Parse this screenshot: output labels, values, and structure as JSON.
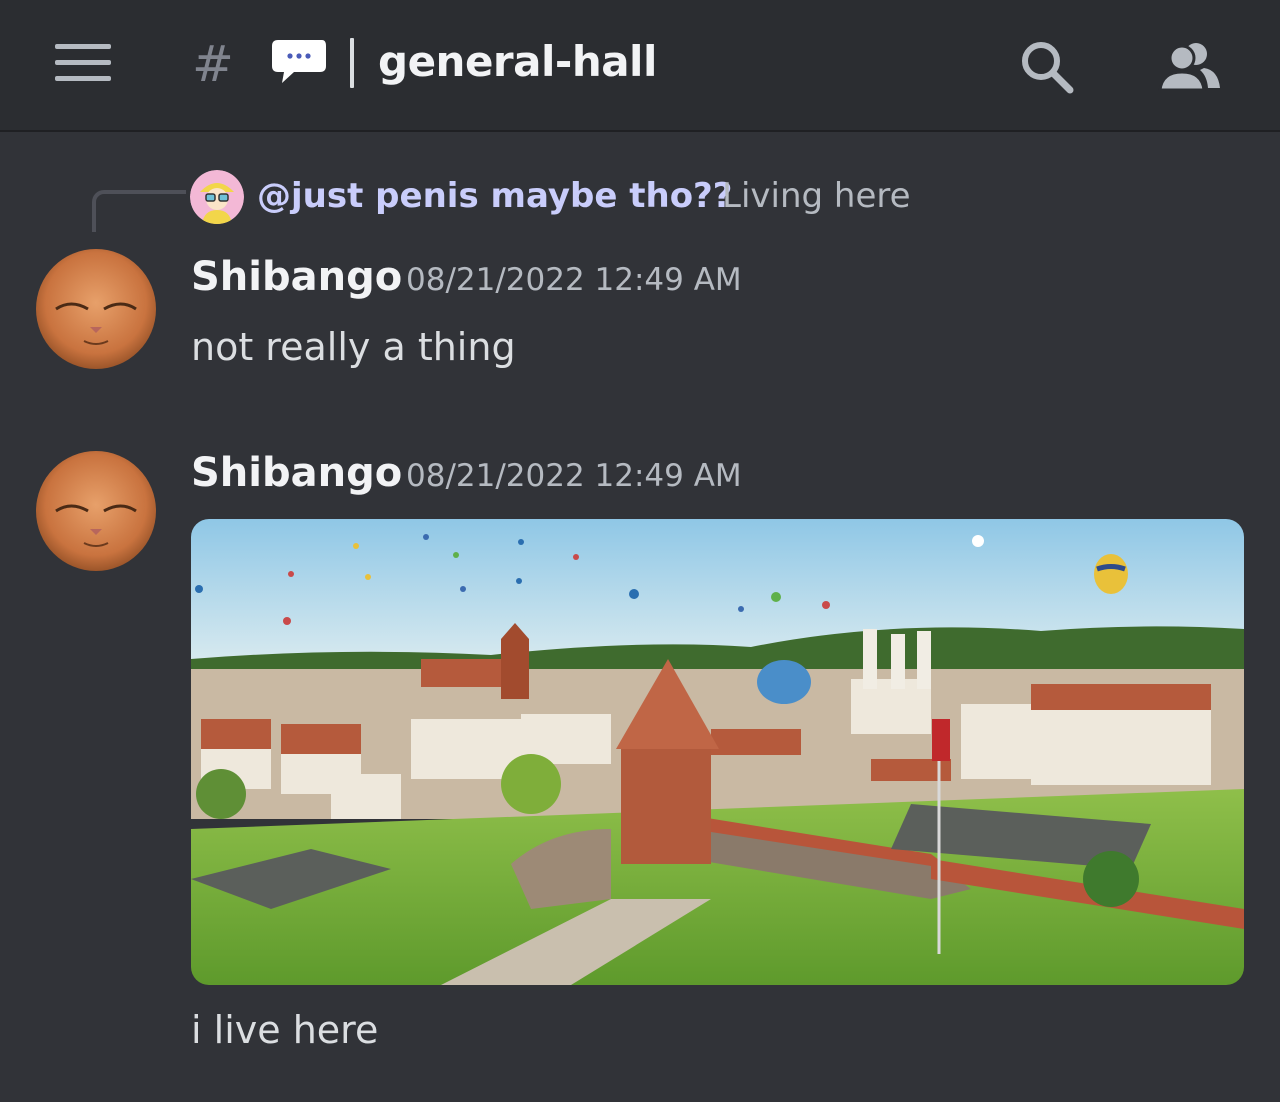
{
  "header": {
    "channel_name": "general-hall",
    "hash_symbol": "#",
    "channel_emoji": "speech-balloon-icon"
  },
  "reply": {
    "username": "@just penis maybe tho??",
    "preview_text": "Living here"
  },
  "messages": [
    {
      "username": "Shibango",
      "timestamp": "08/21/2022 12:49 AM",
      "text": "not really a thing"
    },
    {
      "username": "Shibango",
      "timestamp": "08/21/2022 12:49 AM",
      "attachment": "image of castle with hot air balloons",
      "text": "i live here"
    }
  ],
  "colors": {
    "background": "#313338",
    "header_bg": "#2b2d31",
    "reply_user": "#c9cdfb",
    "text": "#dbdee1",
    "muted": "#b5bac1"
  }
}
